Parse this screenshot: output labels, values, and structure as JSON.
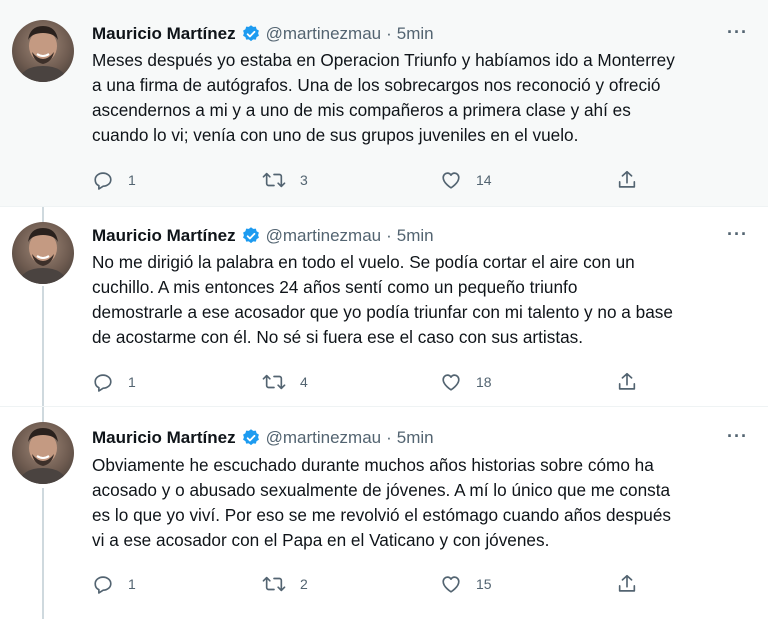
{
  "tweets": [
    {
      "author": {
        "name": "Mauricio Martínez",
        "handle": "@martinezmau",
        "verified": true
      },
      "dot": "·",
      "time": "5min",
      "more": "···",
      "text": "Meses después yo estaba en Operacion Triunfo y habíamos ido a Monterrey\na una firma de autógrafos. Una de los sobrecargos nos reconoció y ofreció\nascendernos a mi y a uno de mis compañeros a primera clase y ahí es\ncuando lo vi; venía con uno de sus grupos juveniles en el vuelo.",
      "replies": "1",
      "retweets": "3",
      "likes": "14"
    },
    {
      "author": {
        "name": "Mauricio Martínez",
        "handle": "@martinezmau",
        "verified": true
      },
      "dot": "·",
      "time": "5min",
      "more": "···",
      "text": "No me dirigió la palabra en todo el vuelo. Se podía cortar el aire con un\ncuchillo. A mis entonces 24 años sentí como un pequeño triunfo\ndemostrarle a ese acosador que yo podía triunfar con mi talento y no a base\nde acostarme con él. No sé si fuera ese el caso con sus artistas.",
      "replies": "1",
      "retweets": "4",
      "likes": "18"
    },
    {
      "author": {
        "name": "Mauricio Martínez",
        "handle": "@martinezmau",
        "verified": true
      },
      "dot": "·",
      "time": "5min",
      "more": "···",
      "text": "Obviamente he escuchado durante muchos años historias sobre cómo ha\nacosado y o abusado sexualmente de jóvenes. A mí lo único que me consta\nes lo que yo viví. Por eso se me revolvió el estómago cuando años después\nvi a ese acosador con el Papa en el Vaticano y con jóvenes.",
      "replies": "1",
      "retweets": "2",
      "likes": "15"
    }
  ],
  "colors": {
    "verified": "#1d9bf0",
    "icon_gray": "#536471",
    "thread_line": "#cfd9de",
    "highlight_bg": "#f7f9f9"
  },
  "icons": [
    "verified-badge-icon",
    "more-icon",
    "reply-icon",
    "retweet-icon",
    "like-icon",
    "share-icon"
  ]
}
